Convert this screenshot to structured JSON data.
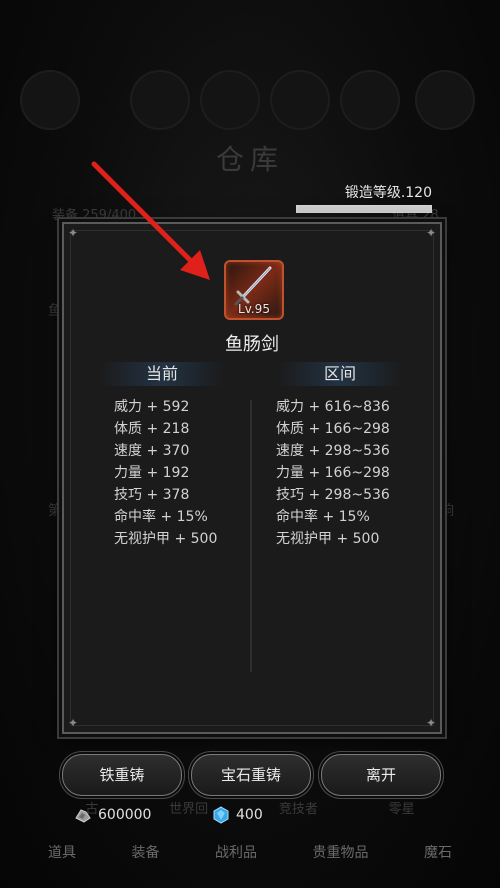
{
  "background": {
    "title": "仓库",
    "count_left": "装备 259/400",
    "count_right": "道具 28",
    "side_left": "鱼",
    "side_left_2": "第",
    "side_right": "响",
    "strip": [
      "古",
      "世界回",
      "竞技者",
      "零星"
    ]
  },
  "forge": {
    "label": "锻造等级.120",
    "progress": 1.0
  },
  "item": {
    "level": "Lv.95",
    "name": "鱼肠剑",
    "border_color": "#c1502b"
  },
  "columns": {
    "current_header": "当前",
    "range_header": "区间"
  },
  "current_stats": [
    "威力 + 592",
    "体质 + 218",
    "速度 + 370",
    "力量 + 192",
    "技巧 + 378",
    "命中率 + 15%",
    "无视护甲 + 500"
  ],
  "range_stats": [
    "威力 + 616~836",
    "体质 + 166~298",
    "速度 + 298~536",
    "力量 + 166~298",
    "技巧 + 298~536",
    "命中率 + 15%",
    "无视护甲 + 500"
  ],
  "buttons": {
    "iron_recast": "铁重铸",
    "gem_recast": "宝石重铸",
    "leave": "离开"
  },
  "currency": {
    "iron_amount": "600000",
    "gem_amount": "400",
    "iron_icon": "iron-ore-icon",
    "gem_icon": "blue-gem-icon"
  },
  "tabs": [
    "道具",
    "装备",
    "战利品",
    "贵重物品",
    "魔石"
  ],
  "colors": {
    "annotation_arrow": "#e0201b",
    "gem": "#3aa8e6"
  }
}
